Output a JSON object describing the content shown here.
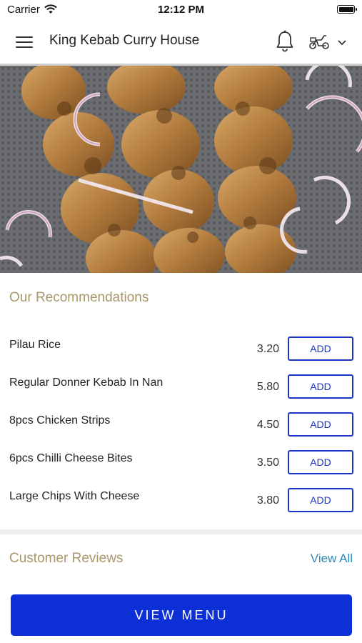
{
  "status_bar": {
    "carrier": "Carrier",
    "time": "12:12 PM"
  },
  "header": {
    "title": "King Kebab Curry House",
    "icons": [
      "menu-icon",
      "bell-icon",
      "scooter-icon",
      "chevron-down-icon"
    ]
  },
  "recommendations": {
    "title": "Our Recommendations",
    "items": [
      {
        "name": "Pilau Rice",
        "price": "3.20",
        "button": "ADD"
      },
      {
        "name": "Regular Donner Kebab In Nan",
        "price": "5.80",
        "button": "ADD"
      },
      {
        "name": "8pcs Chicken Strips",
        "price": "4.50",
        "button": "ADD"
      },
      {
        "name": "6pcs Chilli Cheese Bites",
        "price": "3.50",
        "button": "ADD"
      },
      {
        "name": "Large Chips With Cheese",
        "price": "3.80",
        "button": "ADD"
      }
    ]
  },
  "reviews": {
    "title": "Customer Reviews",
    "view_all": "View All"
  },
  "footer": {
    "view_menu": "VIEW MENU"
  },
  "colors": {
    "accent": "#0d2fd6",
    "section_title": "#a8976b",
    "link": "#2a8ab5"
  }
}
